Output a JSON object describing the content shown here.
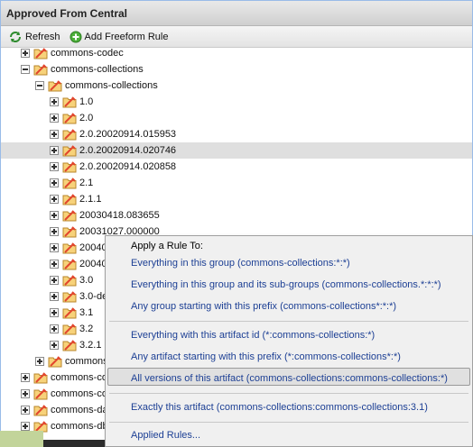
{
  "panel": {
    "title": "Approved From Central"
  },
  "toolbar": {
    "refresh_label": "Refresh",
    "add_label": "Add Freeform Rule"
  },
  "tree": {
    "nodes": [
      {
        "label": "commons-codec",
        "level": 1,
        "expanded": false
      },
      {
        "label": "commons-collections",
        "level": 1,
        "expanded": true
      },
      {
        "label": "commons-collections",
        "level": 2,
        "expanded": true
      },
      {
        "label": "1.0",
        "level": 3,
        "expanded": false
      },
      {
        "label": "2.0",
        "level": 3,
        "expanded": false
      },
      {
        "label": "2.0.20020914.015953",
        "level": 3,
        "expanded": false
      },
      {
        "label": "2.0.20020914.020746",
        "level": 3,
        "expanded": false,
        "selected": true
      },
      {
        "label": "2.0.20020914.020858",
        "level": 3,
        "expanded": false
      },
      {
        "label": "2.1",
        "level": 3,
        "expanded": false
      },
      {
        "label": "2.1.1",
        "level": 3,
        "expanded": false
      },
      {
        "label": "20030418.083655",
        "level": 3,
        "expanded": false
      },
      {
        "label": "20031027.000000",
        "level": 3,
        "expanded": false
      },
      {
        "label": "20040",
        "level": 3,
        "expanded": false
      },
      {
        "label": "20040",
        "level": 3,
        "expanded": false
      },
      {
        "label": "3.0",
        "level": 3,
        "expanded": false
      },
      {
        "label": "3.0-de",
        "level": 3,
        "expanded": false
      },
      {
        "label": "3.1",
        "level": 3,
        "expanded": false
      },
      {
        "label": "3.2",
        "level": 3,
        "expanded": false
      },
      {
        "label": "3.2.1",
        "level": 3,
        "expanded": false
      },
      {
        "label": "commons",
        "level": 2,
        "expanded": false
      },
      {
        "label": "commons-co",
        "level": 1,
        "expanded": false
      },
      {
        "label": "commons-co",
        "level": 1,
        "expanded": false
      },
      {
        "label": "commons-da",
        "level": 1,
        "expanded": false
      },
      {
        "label": "commons-db",
        "level": 1,
        "expanded": false
      }
    ]
  },
  "context_menu": {
    "header": "Apply a Rule To:",
    "items": [
      {
        "label": "Everything in this group (commons-collections:*:*)"
      },
      {
        "label": "Everything in this group and its sub-groups (commons-collections.*:*:*)"
      },
      {
        "label": "Any group starting with this prefix (commons-collections*:*:*)"
      },
      {
        "label": "Everything with this artifact id (*:commons-collections:*)"
      },
      {
        "label": "Any artifact starting with this prefix (*:commons-collections*:*)"
      },
      {
        "label": "All versions of this artifact (commons-collections:commons-collections:*)",
        "active": true
      },
      {
        "label": "Exactly this artifact (commons-collections:commons-collections:3.1)"
      },
      {
        "label": "Applied Rules..."
      }
    ]
  },
  "colors": {
    "accent_link": "#1c3f94",
    "selection": "#dfdfdf",
    "menu_bg": "#f0f0f0"
  }
}
